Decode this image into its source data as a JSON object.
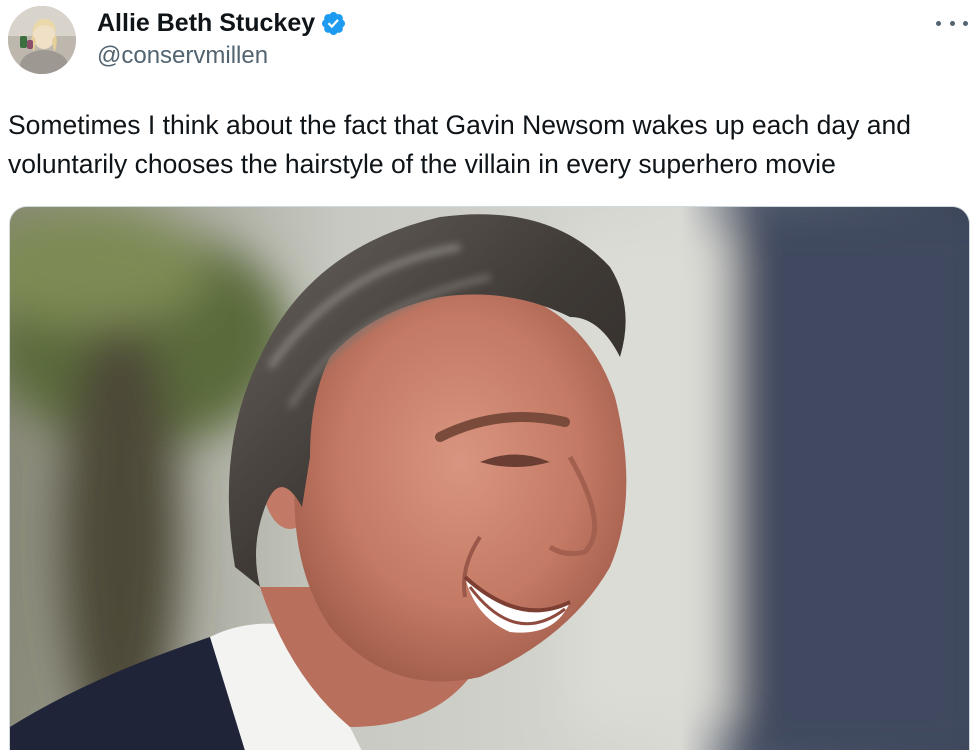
{
  "author": {
    "display_name": "Allie Beth Stuckey",
    "handle": "@conservmillen",
    "verified": true,
    "verified_color": "#1d9bf0"
  },
  "menu_icon": "more-horizontal-icon",
  "tweet": {
    "text": "Sometimes I think about the fact that Gavin Newsom wakes up each day and voluntarily chooses the hairstyle of the villain in every superhero movie"
  },
  "colors": {
    "text_primary": "#0f1419",
    "text_secondary": "#536471",
    "border": "#cfd9de"
  }
}
